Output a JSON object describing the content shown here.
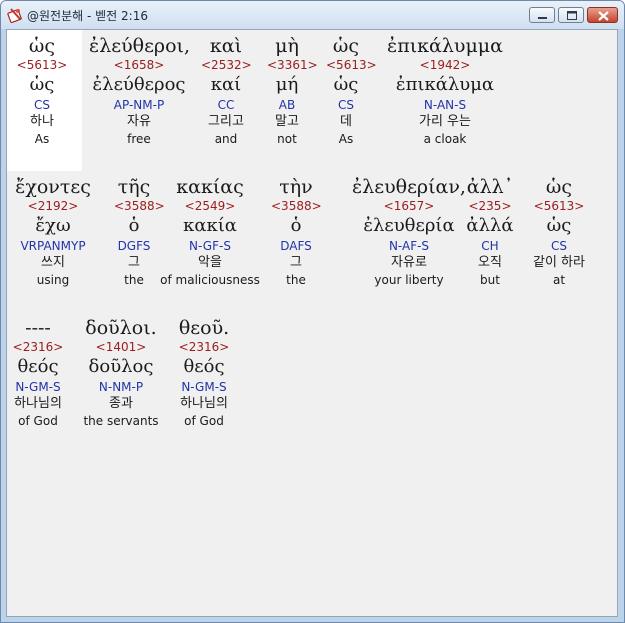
{
  "window": {
    "title": "@원전분해 - 벧전 2:16"
  },
  "controls": {
    "minimize_icon": "minimize-icon",
    "maximize_icon": "maximize-icon",
    "close_icon": "close-icon"
  },
  "rows": [
    {
      "words": [
        {
          "greek": "ὡς",
          "strong": "<5613>",
          "lemma": "ὡς",
          "morph": "CS",
          "korean": "하나",
          "english": "As"
        },
        {
          "greek": "ἐλεύθεροι,",
          "strong": "<1658>",
          "lemma": "ἐλεύθερος",
          "morph": "AP-NM-P",
          "korean": "자유",
          "english": "free"
        },
        {
          "greek": "καὶ",
          "strong": "<2532>",
          "lemma": "καί",
          "morph": "CC",
          "korean": "그리고",
          "english": "and"
        },
        {
          "greek": "μὴ",
          "strong": "<3361>",
          "lemma": "μή",
          "morph": "AB",
          "korean": "말고",
          "english": "not"
        },
        {
          "greek": "ὡς",
          "strong": "<5613>",
          "lemma": "ὡς",
          "morph": "CS",
          "korean": "데",
          "english": "As"
        },
        {
          "greek": "ἐπικάλυμμα",
          "strong": "<1942>",
          "lemma": "ἐπικάλυμα",
          "morph": "N-AN-S",
          "korean": "가리 우는",
          "english": "a cloak"
        }
      ]
    },
    {
      "words": [
        {
          "greek": "ἔχοντες",
          "strong": "<2192>",
          "lemma": "ἔχω",
          "morph": "VRPANMYP",
          "korean": "쓰지",
          "english": "using"
        },
        {
          "greek": "τῆς",
          "strong": "<3588>",
          "lemma": "ὁ",
          "morph": "DGFS",
          "korean": "그",
          "english": "the"
        },
        {
          "greek": "κακίας",
          "strong": "<2549>",
          "lemma": "κακία",
          "morph": "N-GF-S",
          "korean": "악을",
          "english": "of maliciousness"
        },
        {
          "greek": "τὴν",
          "strong": "<3588>",
          "lemma": "ὁ",
          "morph": "DAFS",
          "korean": "그",
          "english": "the"
        },
        {
          "greek": "ἐλευθερίαν,",
          "strong": "<1657>",
          "lemma": "ἐλευθερία",
          "morph": "N-AF-S",
          "korean": "자유로",
          "english": "your liberty"
        },
        {
          "greek": "ἀλλ᾽",
          "strong": "<235>",
          "lemma": "ἀλλά",
          "morph": "CH",
          "korean": "오직",
          "english": "but"
        },
        {
          "greek": "ὡς",
          "strong": "<5613>",
          "lemma": "ὡς",
          "morph": "CS",
          "korean": "같이 하라",
          "english": "at"
        }
      ]
    },
    {
      "words": [
        {
          "greek": "----",
          "strong": "<2316>",
          "lemma": "θεός",
          "morph": "N-GM-S",
          "korean": "하나님의",
          "english": "of God"
        },
        {
          "greek": "δοῦλοι.",
          "strong": "<1401>",
          "lemma": "δοῦλος",
          "morph": "N-NM-P",
          "korean": "종과",
          "english": "the servants"
        },
        {
          "greek": "θεοῦ.",
          "strong": "<2316>",
          "lemma": "θεός",
          "morph": "N-GM-S",
          "korean": "하나님의",
          "english": "of God"
        }
      ]
    }
  ]
}
